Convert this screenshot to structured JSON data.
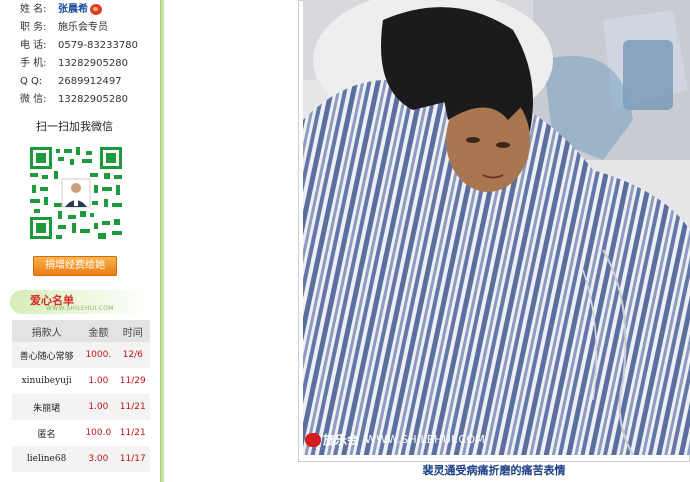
{
  "profile": {
    "name_label": "姓 名:",
    "name_value": "张晨希",
    "role_label": "职 务:",
    "role_value": "施乐会专员",
    "phone_label": "电 话:",
    "phone_value": "0579-83233780",
    "mobile_label": "手 机:",
    "mobile_value": "13282905280",
    "qq_label": "Q   Q:",
    "qq_value": "2689912497",
    "wechat_label": "微 信:",
    "wechat_value": "13282905280"
  },
  "scan_prompt": "扫一扫加我微信",
  "donate_button": "捐增经费给她",
  "love_list": {
    "title": "爱心名单",
    "subtitle": "WWW.SHILEHUI.COM",
    "headers": [
      "捐款人",
      "金额",
      "时间"
    ],
    "rows": [
      {
        "donor": "善心随心常够",
        "amount": "1000.",
        "time": "12/6"
      },
      {
        "donor": "xinuibeyuji",
        "amount": "1.00",
        "time": "11/29"
      },
      {
        "donor": "朱丽珺",
        "amount": "1.00",
        "time": "11/21"
      },
      {
        "donor": "匿名",
        "amount": "100.0",
        "time": "11/21"
      },
      {
        "donor": "lieline68",
        "amount": "3.00",
        "time": "11/17"
      }
    ]
  },
  "photo": {
    "watermark_brand": "施乐会",
    "watermark_url": "WWW.SHILEHUI.COM",
    "caption": "裴灵通受病痛折磨的痛苦表情"
  },
  "colors": {
    "accent_green": "#c9e4a5",
    "caption_blue": "#1a3e86",
    "amount_red": "#c21414",
    "button_orange": "#ea7d12"
  }
}
